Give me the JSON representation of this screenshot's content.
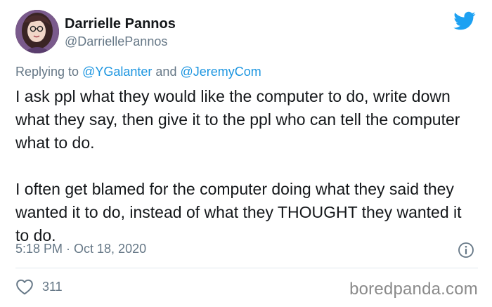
{
  "author": {
    "name": "Darrielle Pannos",
    "handle": "@DarriellePannos"
  },
  "reply_context": {
    "prefix": "Replying to",
    "mention_1": "@YGalanter",
    "connector": "and",
    "mention_2": "@JeremyCom"
  },
  "tweet": {
    "paragraph_1": "I ask ppl what they would like the computer to do, write down what they say, then give it to the ppl who can tell the computer what to do.",
    "paragraph_2": "I often get blamed for the computer doing what they said they wanted it to do, instead of what they THOUGHT they wanted it to do.",
    "timestamp": "5:18 PM · Oct 18, 2020"
  },
  "engagement": {
    "like_count": "311"
  },
  "watermark": "boredpanda.com",
  "icons": {
    "platform": "twitter-bird-icon",
    "info": "info-icon",
    "like": "heart-icon"
  },
  "colors": {
    "brand_blue": "#1da1f2",
    "link_blue": "#1b95e0",
    "secondary_text": "#657786",
    "primary_text": "#14171a"
  }
}
